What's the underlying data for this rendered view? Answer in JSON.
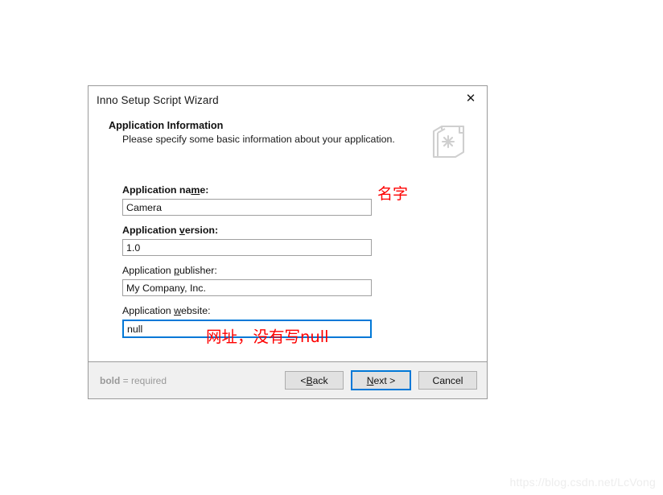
{
  "window": {
    "title": "Inno Setup Script Wizard",
    "close_icon": "close-icon"
  },
  "header": {
    "title": "Application Information",
    "subtitle": "Please specify some basic information about your application.",
    "icon": "book-document-icon"
  },
  "form": {
    "fields": [
      {
        "label_before": "Application na",
        "label_accel": "m",
        "label_after": "e:",
        "required": true,
        "value": "Camera",
        "focused": false,
        "name": "application-name"
      },
      {
        "label_before": "Application ",
        "label_accel": "v",
        "label_after": "ersion:",
        "required": true,
        "value": "1.0",
        "focused": false,
        "name": "application-version"
      },
      {
        "label_before": "Application ",
        "label_accel": "p",
        "label_after": "ublisher:",
        "required": false,
        "value": "My Company, Inc.",
        "focused": false,
        "name": "application-publisher"
      },
      {
        "label_before": "Application ",
        "label_accel": "w",
        "label_after": "ebsite:",
        "required": false,
        "value": "null",
        "focused": true,
        "name": "application-website"
      }
    ]
  },
  "footer": {
    "note_bold": "bold",
    "note_rest": " = required",
    "buttons": [
      {
        "before": "< ",
        "accel": "B",
        "after": "ack",
        "default": false,
        "name": "back-button"
      },
      {
        "before": "",
        "accel": "N",
        "after": "ext >",
        "default": true,
        "name": "next-button"
      },
      {
        "before": "Cancel",
        "accel": "",
        "after": "",
        "default": false,
        "name": "cancel-button"
      }
    ]
  },
  "annotations": {
    "name_note": "名字",
    "website_note": "网址，没有写null"
  },
  "watermark": "https://blog.csdn.net/LcVong",
  "colors": {
    "accent": "#0078d7",
    "annotation": "#fe0000",
    "footer_bg": "#f0f0f0",
    "border": "#9a9a9a"
  }
}
